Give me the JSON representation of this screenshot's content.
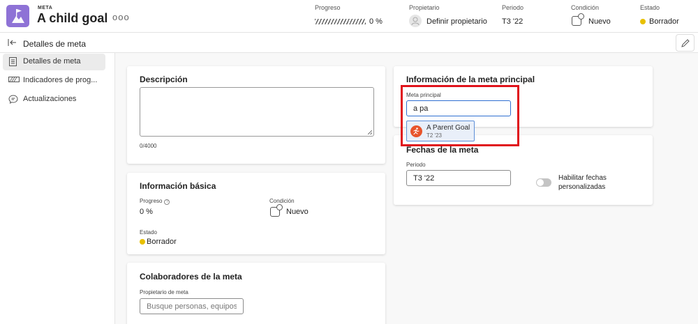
{
  "header": {
    "kicker": "META",
    "title": "A child goal",
    "more": "ooo",
    "progress": {
      "label": "Progreso",
      "value": "0 %"
    },
    "owner": {
      "label": "Propietario",
      "value": "Definir propietario"
    },
    "period": {
      "label": "Periodo",
      "value": "T3 '22"
    },
    "condition": {
      "label": "Condición",
      "value": "Nuevo"
    },
    "status": {
      "label": "Estado",
      "value": "Borrador"
    }
  },
  "subheader": {
    "title": "Detalles de meta",
    "back_icon": "back-arrow-icon",
    "edit_icon": "pencil-icon"
  },
  "sidebar": {
    "items": [
      {
        "label": "Detalles de meta",
        "icon": "document-icon",
        "active": true
      },
      {
        "label": "Indicadores de prog...",
        "icon": "progress-icon",
        "active": false
      },
      {
        "label": "Actualizaciones",
        "icon": "comment-icon",
        "active": false
      }
    ]
  },
  "description": {
    "title": "Descripción",
    "counter": "0/4000"
  },
  "basic_info": {
    "title": "Información básica",
    "progress_label": "Progreso",
    "progress_value": "0 %",
    "condition_label": "Condición",
    "condition_value": "Nuevo",
    "status_label": "Estado",
    "status_value": "Borrador"
  },
  "collaborators": {
    "title": "Colaboradores de la meta",
    "owner_label": "Propietario de meta",
    "owner_placeholder": "Busque personas, equipos,..."
  },
  "parent_goal": {
    "title": "Información de la meta principal",
    "field_label": "Meta principal",
    "field_value": "a pa",
    "suggestion": {
      "name": "A Parent Goal",
      "period": "T2 '23"
    }
  },
  "goal_dates": {
    "title": "Fechas de la meta",
    "period_label": "Periodo",
    "period_value": "T3 '22",
    "toggle_label_1": "Habilitar fechas",
    "toggle_label_2": "personalizadas",
    "custom_dates_enabled": false
  },
  "colors": {
    "accent": "#8e72d6",
    "status_draft": "#e8c000",
    "highlight": "#e0121a",
    "suggestion_icon": "#e8542b"
  }
}
